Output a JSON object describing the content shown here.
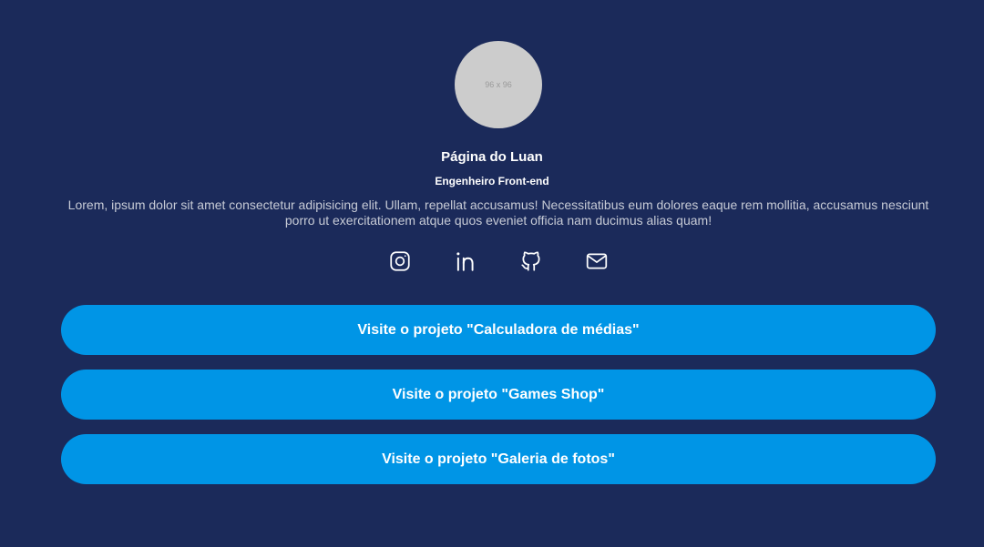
{
  "profile": {
    "avatar_placeholder": "96 x 96",
    "name": "Página do Luan",
    "role": "Engenheiro Front-end",
    "bio": "Lorem, ipsum dolor sit amet consectetur adipisicing elit. Ullam, repellat accusamus! Necessitatibus eum dolores eaque rem mollitia, accusamus nesciunt porro ut exercitationem atque quos eveniet officia nam ducimus alias quam!"
  },
  "social": {
    "icons": [
      "instagram-icon",
      "linkedin-icon",
      "github-icon",
      "email-icon"
    ]
  },
  "links": [
    {
      "label": "Visite o projeto \"Calculadora de médias\""
    },
    {
      "label": "Visite o projeto \"Games Shop\""
    },
    {
      "label": "Visite o projeto \"Galeria de fotos\""
    }
  ],
  "colors": {
    "background": "#1b2a5a",
    "button": "#0095e6",
    "avatar": "#cccccc",
    "text": "#ffffff",
    "muted_text": "#c7cbd6"
  }
}
